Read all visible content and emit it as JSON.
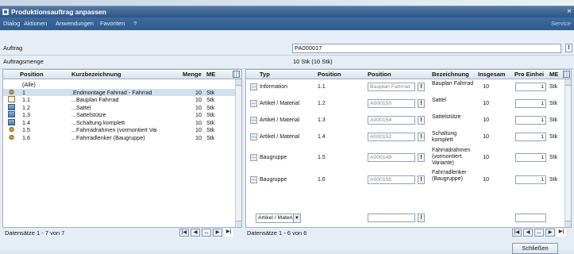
{
  "window": {
    "title": "Produktionsauftrag anpassen",
    "close": "×"
  },
  "menu": [
    "Dialog",
    "Aktionen",
    "Anwendungen",
    "Favoriten",
    "?"
  ],
  "menu_service": "Service",
  "fields": {
    "auftrag_label": "Auftrag",
    "auftrag_value": "PA000017",
    "auftragsmenge_label": "Auftragsmenge",
    "auftragsmenge_value": "10 Stk (10 Stk)"
  },
  "left_table": {
    "headers": {
      "position": "Position",
      "kurz": "Kurzbezeichnung",
      "menge": "Menge",
      "me": "ME"
    },
    "rows": [
      {
        "pos": "(Alle)",
        "kurz": "",
        "menge": "",
        "me": "",
        "icon": "none"
      },
      {
        "pos": "1",
        "kurz": ".Endmontage Fahrrad - Fahrrad",
        "menge": "10",
        "me": "Stk",
        "icon": "gear"
      },
      {
        "pos": "1.1",
        "kurz": "...Bauplan Fahrrad",
        "menge": "10",
        "me": "Stk",
        "icon": "doc"
      },
      {
        "pos": "1.2",
        "kurz": "...Sattel",
        "menge": "10",
        "me": "Stk",
        "icon": "box"
      },
      {
        "pos": "1.3",
        "kurz": "...Sattelstütze",
        "menge": "10",
        "me": "Stk",
        "icon": "box"
      },
      {
        "pos": "1.4",
        "kurz": "...Schaltung komplett",
        "menge": "10",
        "me": "Stk",
        "icon": "box"
      },
      {
        "pos": "1.5",
        "kurz": "...Fahrradrahmen (vormontiert Vai",
        "menge": "10",
        "me": "Stk",
        "icon": "gear"
      },
      {
        "pos": "1.6",
        "kurz": "...Fahrradlenker (Baugruppe)",
        "menge": "10",
        "me": "Stk",
        "icon": "gear"
      }
    ],
    "status": "Datensätze 1 - 7 von 7"
  },
  "right_table": {
    "headers": {
      "typ": "Typ",
      "position": "Position",
      "position2": "Position",
      "bezeichnung": "Bezeichnung",
      "insgesamt": "Insgesam",
      "pro": "Pro Einhei",
      "me": "ME"
    },
    "rows": [
      {
        "typ": "Information",
        "pos": "1.1",
        "ref": "Bauplan Fahrrad",
        "bez": "Bauplan Fahrrad",
        "ins": "10",
        "pro": "1",
        "me": "Stk"
      },
      {
        "typ": "Artikel / Material",
        "pos": "1.2",
        "ref": "A000150",
        "bez": "Sattel",
        "ins": "10",
        "pro": "1",
        "me": "Stk"
      },
      {
        "typ": "Artikel / Material",
        "pos": "1.3",
        "ref": "A000154",
        "bez": "Sattelstütze",
        "ins": "10",
        "pro": "1",
        "me": "Stk"
      },
      {
        "typ": "Artikel / Material",
        "pos": "1.4",
        "ref": "A000152",
        "bez": "Schaltung komplett",
        "ins": "10",
        "pro": "1",
        "me": "Stk"
      },
      {
        "typ": "Baugruppe",
        "pos": "1.5",
        "ref": "A000149",
        "bez": "Fahrradrahmen (vormontiert Variante)",
        "ins": "10",
        "pro": "1",
        "me": "Stk"
      },
      {
        "typ": "Baugruppe",
        "pos": "1.6",
        "ref": "A000155",
        "bez": "Fahrradlenker (Baugruppe)",
        "ins": "10",
        "pro": "1",
        "me": "Stk"
      }
    ],
    "new_row_type": "Artikel / Materia",
    "status": "Datensätze 1 - 6 von 6"
  },
  "buttons": {
    "close": "Schließen",
    "ellipsis": "...",
    "excl": "!"
  },
  "nav": {
    "first": "|◀",
    "prev": "◀",
    "dots": "...",
    "next": "▶",
    "last": "▶|"
  }
}
